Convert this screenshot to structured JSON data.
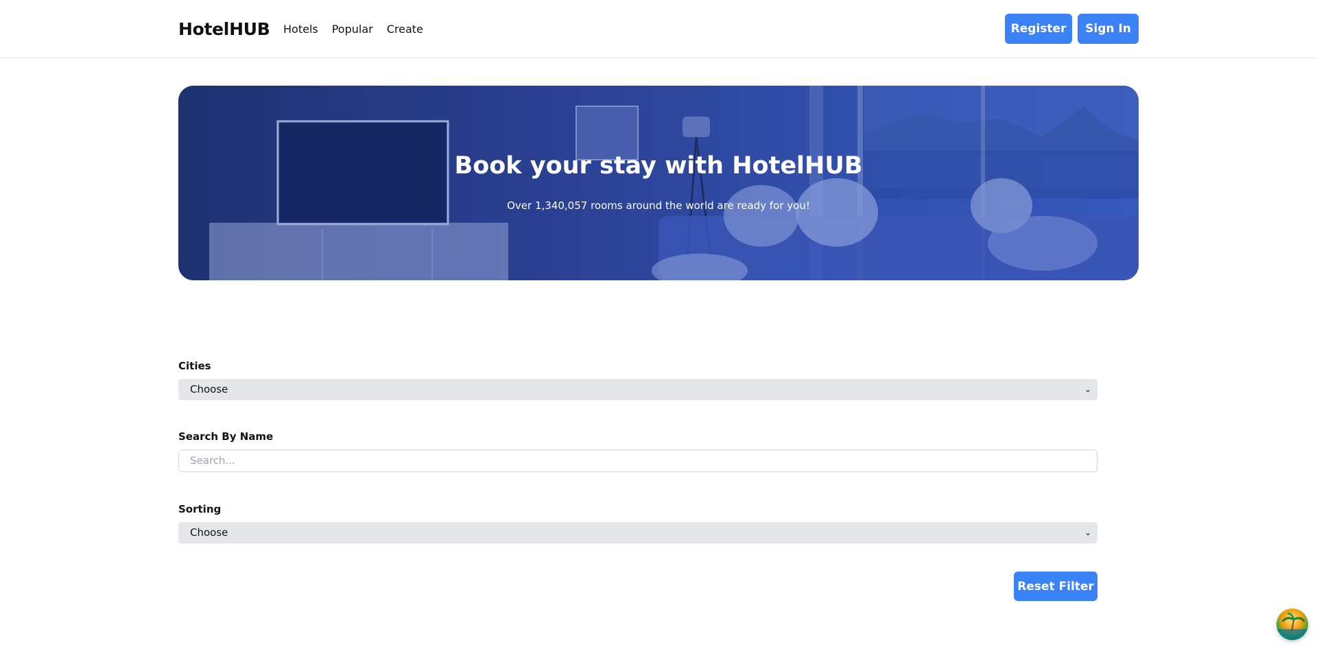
{
  "header": {
    "logo": "HotelHUB",
    "nav": [
      "Hotels",
      "Popular",
      "Create"
    ],
    "register_label": "Register",
    "signin_label": "Sign In"
  },
  "hero": {
    "title": "Book your stay with HotelHUB",
    "subtitle": "Over 1,340,057 rooms around the world are ready for you!"
  },
  "filters": {
    "cities_label": "Cities",
    "cities_value": "Choose",
    "search_label": "Search By Name",
    "search_placeholder": "Search...",
    "sorting_label": "Sorting",
    "sorting_value": "Choose",
    "reset_label": "Reset Filter"
  },
  "colors": {
    "accent": "#3b82f6",
    "hero_overlay": "#2a3c86"
  }
}
